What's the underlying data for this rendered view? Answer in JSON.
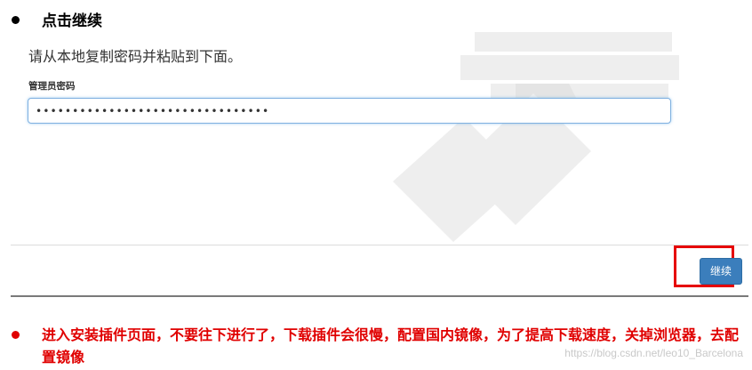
{
  "step_heading": "点击继续",
  "instruction": "请从本地复制密码并粘贴到下面。",
  "password_field": {
    "label": "管理员密码",
    "value": "••••••••••••••••••••••••••••••••"
  },
  "continue_button": {
    "label": "继续"
  },
  "note": "进入安装插件页面，不要往下进行了，下载插件会很慢，配置国内镜像，为了提高下载速度，关掉浏览器，去配置镜像",
  "url_watermark": "https://blog.csdn.net/leo10_Barcelona",
  "colors": {
    "bullet_main": "#000000",
    "note_red": "#e00000",
    "highlight_frame": "#e60000",
    "button_blue": "#3b7ebc",
    "input_focus_border": "#7fb0e0"
  },
  "icons": {
    "watermark": "jenkins-key-icon"
  }
}
